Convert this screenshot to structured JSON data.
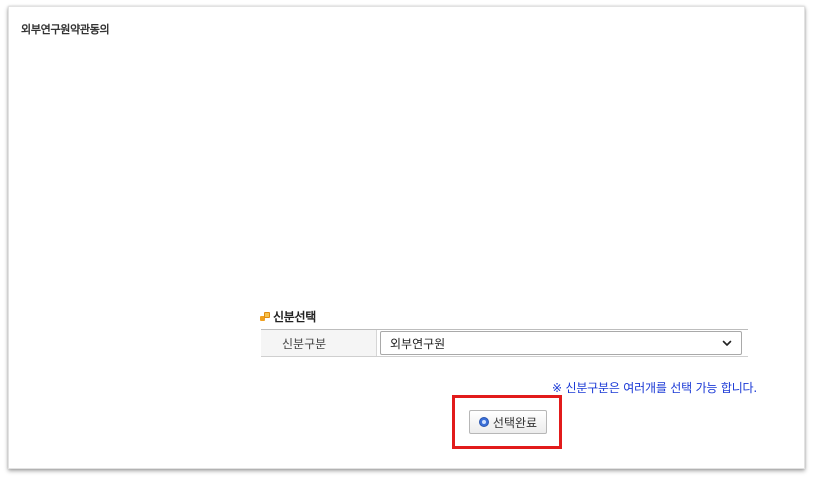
{
  "page": {
    "title": "외부연구원약관동의"
  },
  "identity_section": {
    "title": "신분선택",
    "icon": "section-bullet-icon",
    "field_label": "신분구분",
    "selected_value": "외부연구원",
    "notice": "※ 신분구분은 여러개를 선택 가능 합니다."
  },
  "actions": {
    "complete_label": "선택완료",
    "complete_icon": "circle-dot-icon"
  },
  "colors": {
    "notice_text": "#1a39d6",
    "highlight_border": "#e21b1b",
    "section_icon": "#f0a020"
  }
}
